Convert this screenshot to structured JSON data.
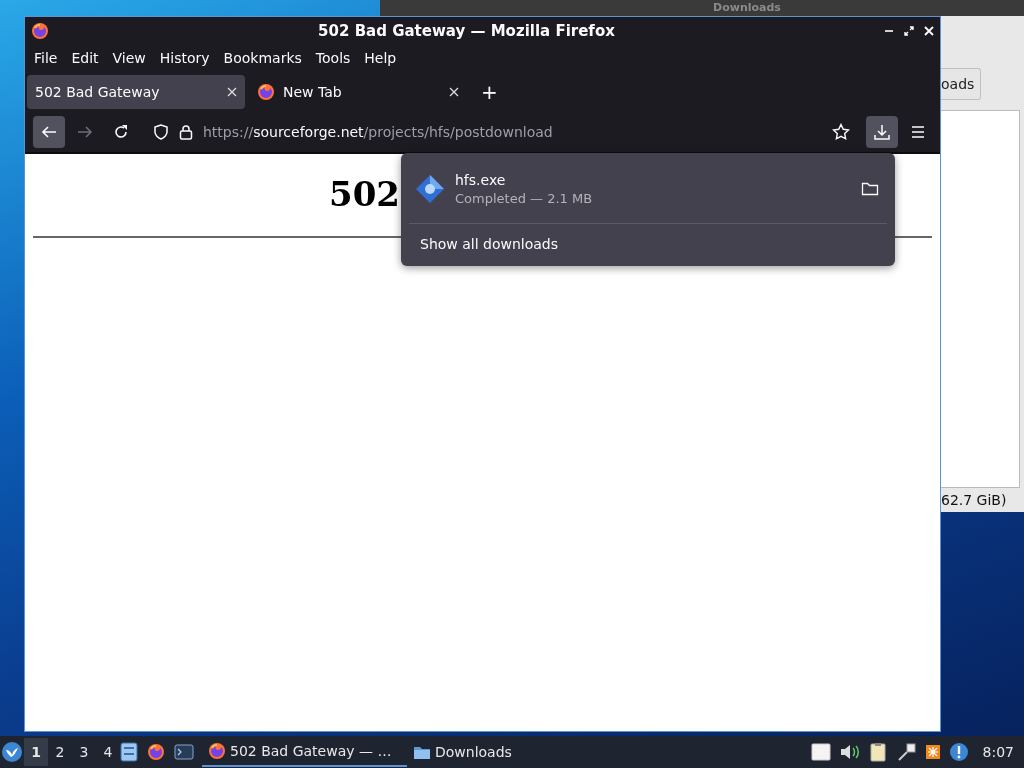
{
  "background_window": {
    "title": "Downloads",
    "button": "oads",
    "status": "62.7 GiB)"
  },
  "browser": {
    "title": "502 Bad Gateway — Mozilla Firefox",
    "menu": [
      "File",
      "Edit",
      "View",
      "History",
      "Bookmarks",
      "Tools",
      "Help"
    ],
    "tabs": [
      {
        "label": "502 Bad Gateway",
        "selected": true,
        "favicon": false
      },
      {
        "label": "New Tab",
        "selected": false,
        "favicon": true
      }
    ],
    "new_tab": "+",
    "nav": {
      "back_disabled": false,
      "forward_disabled": true,
      "downloads_open": true
    },
    "url": {
      "scheme": "https://",
      "host": "sourceforge.net",
      "path": "/projects/hfs/postdownload"
    },
    "page": {
      "heading": "502"
    },
    "downloads_panel": {
      "items": [
        {
          "name": "hfs.exe",
          "status": "Completed — 2.1 MB"
        }
      ],
      "footer": "Show all downloads"
    }
  },
  "taskbar": {
    "workspaces": [
      {
        "label": "1",
        "selected": true
      },
      {
        "label": "2",
        "selected": false
      },
      {
        "label": "3",
        "selected": false
      },
      {
        "label": "4",
        "selected": false
      }
    ],
    "tasks": [
      {
        "label": "502 Bad Gateway — …",
        "selected": true
      },
      {
        "label": "Downloads",
        "selected": false
      }
    ],
    "clock": "8:07"
  }
}
